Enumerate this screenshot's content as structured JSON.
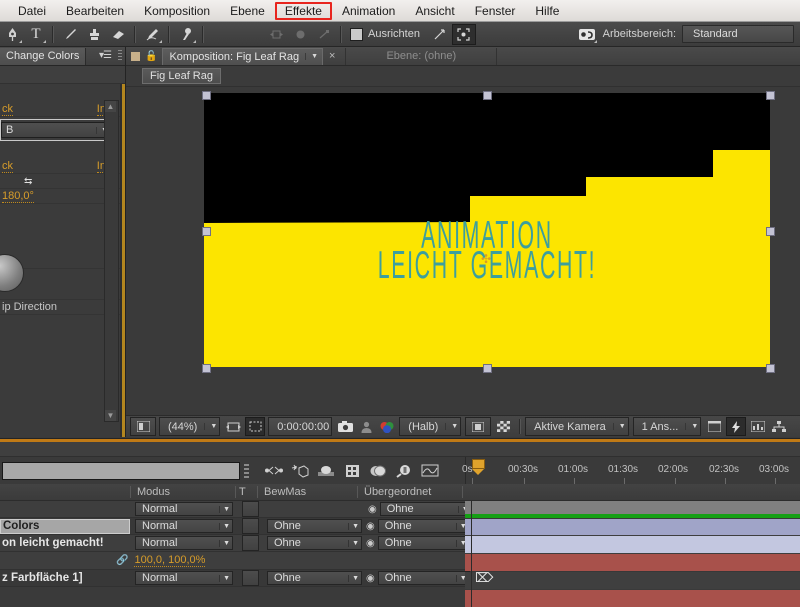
{
  "menubar": {
    "items": [
      {
        "label": "Datei",
        "highlighted": false
      },
      {
        "label": "Bearbeiten",
        "highlighted": false
      },
      {
        "label": "Komposition",
        "highlighted": false
      },
      {
        "label": "Ebene",
        "highlighted": false
      },
      {
        "label": "Effekte",
        "highlighted": true
      },
      {
        "label": "Animation",
        "highlighted": false
      },
      {
        "label": "Ansicht",
        "highlighted": false
      },
      {
        "label": "Fenster",
        "highlighted": false
      },
      {
        "label": "Hilfe",
        "highlighted": false
      }
    ],
    "highlight_color": "#e8251e"
  },
  "toolbar": {
    "tools": [
      {
        "name": "pen-tool",
        "glyph": "✒"
      },
      {
        "name": "text-tool",
        "glyph": "T"
      },
      {
        "name": "brush-tool",
        "glyph": "╱"
      },
      {
        "name": "clone-stamp-tool",
        "glyph": "♟"
      },
      {
        "name": "eraser-tool",
        "glyph": "▰"
      },
      {
        "name": "roto-brush-tool",
        "glyph": "✐"
      },
      {
        "name": "puppet-pin-tool",
        "glyph": "⚙"
      }
    ],
    "align_label": "Ausrichten",
    "align_checked": false,
    "workspace_label": "Arbeitsbereich:",
    "workspace_value": "Standard"
  },
  "effect_panel": {
    "tab_title": "Change Colors",
    "rows": [
      {
        "label": "ck",
        "value": "Int"
      },
      {
        "label": "B",
        "type": "select"
      },
      {
        "label": "ck",
        "value": "Int"
      },
      {
        "label": "",
        "type": "arrows"
      },
      {
        "label": "180,0°",
        "type": "value"
      },
      {
        "label": "ip Direction",
        "type": "text"
      }
    ],
    "angle_value": "180,0°",
    "flip_label": "ip Direction",
    "select_value": "B"
  },
  "composition": {
    "tab_label": "Komposition: Fig Leaf Rag",
    "layer_tab_label": "Ebene: (ohne)",
    "close_glyph": "×",
    "breadcrumb": "Fig Leaf Rag",
    "stage": {
      "background_color": "#000000",
      "shape_color": "#fce500",
      "text_color": "#3d9f9d",
      "line1": "ANIMATION",
      "line2": "LEICHT GEMACHT!",
      "steps_polygon": "0,130 42,130 42,100 155,100 155,84 287,84 287,60 100%,60 100%,100% 0,100%"
    },
    "footer": {
      "zoom": "(44%)",
      "timecode": "0:00:00:00",
      "resolution": "(Halb)",
      "camera": "Aktive Kamera",
      "views": "1 Ans...",
      "toggle_mask_icon": "mask-icon",
      "region_of_interest_icon": "roi-icon",
      "snapshot_icon": "camera-icon",
      "show_snapshot_icon": "person-icon",
      "channels_icon": "rgb-icon",
      "transparency_grid_icon": "grid-icon"
    }
  },
  "timeline": {
    "search_placeholder": "",
    "switch_icons": [
      "shy-icon",
      "frame-blend-icon",
      "motion-blur-icon",
      "graph-editor-icon",
      "3d-icon",
      "effects-icon",
      "solo-icon"
    ],
    "ruler": {
      "labels": [
        "00:30s",
        "01:00s",
        "01:30s",
        "02:00s",
        "02:30s",
        "03:00s"
      ],
      "current_time_marker": "0s"
    },
    "columns": [
      {
        "label": "Modus"
      },
      {
        "label": "T"
      },
      {
        "label": "BewMas"
      },
      {
        "label": "Übergeordnet"
      }
    ],
    "layers": [
      {
        "name": "",
        "selected": false,
        "mode": "Normal",
        "track_matte": "",
        "parent": "Ohne",
        "bar_color": "#808080",
        "bar_accent": "#15a015"
      },
      {
        "name": "Colors",
        "selected": true,
        "mode": "Normal",
        "track_matte": "Ohne",
        "parent": "Ohne",
        "bar_color": "#a0a4c8",
        "bar_accent": ""
      },
      {
        "name": "on leicht gemacht!",
        "selected": false,
        "mode": "Normal",
        "track_matte": "Ohne",
        "parent": "Ohne",
        "bar_color": "#c3c7e0",
        "bar_accent": ""
      },
      {
        "name": "",
        "selected": false,
        "mode": "",
        "track_matte": "",
        "parent": "",
        "scale_value": "100,0, 100,0%",
        "bar_color": "#a8514b",
        "bar_accent": ""
      },
      {
        "name": "z Farbfläche 1]",
        "selected": false,
        "mode": "Normal",
        "track_matte": "Ohne",
        "parent": "Ohne",
        "bar_color": "#3f3f3f",
        "bar_accent": ""
      },
      {
        "name": "",
        "selected": false,
        "mode": "",
        "track_matte": "",
        "parent": "",
        "bar_color": "#a8514b",
        "bar_accent": ""
      }
    ],
    "scale_link_icon": "link-icon",
    "scale_value": "100,0, 100,0%"
  }
}
